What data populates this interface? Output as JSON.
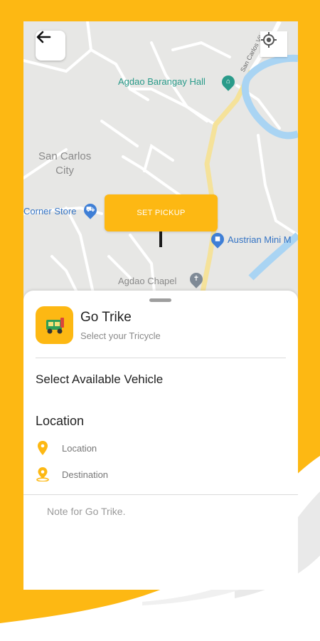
{
  "colors": {
    "brand_yellow": "#FDB813",
    "map_background": "#e7e7e5",
    "road_highlight": "#f5e29a",
    "river": "#a9d4f3",
    "teal_poi": "#2a9b8a",
    "blue_poi": "#3f7fd6",
    "grey_poi": "#7f8a96"
  },
  "map": {
    "labels": {
      "barangay_hall": "Agdao Barangay Hall",
      "city": "San Carlos\nCity",
      "corner_store": "Corner Store",
      "austrian_mini": "Austrian Mini M",
      "chapel": "Agdao Chapel",
      "road": "San Carlos Vil"
    },
    "icons": {
      "back": "arrow-left-icon",
      "locate": "my-location-icon",
      "barangay_hall": "government-building-icon",
      "corner_store": "shopping-cart-icon",
      "austrian_mini": "shopping-bag-icon",
      "chapel": "church-icon"
    },
    "pickup_button": "SET PICKUP"
  },
  "sheet": {
    "app_icon": "tricycle-icon",
    "title": "Go Trike",
    "subtitle": "Select your Tricycle",
    "vehicle_heading": "Select Available Vehicle",
    "location_heading": "Location",
    "location_label": "Location",
    "destination_label": "Destination",
    "note_placeholder": "Note for Go Trike."
  }
}
